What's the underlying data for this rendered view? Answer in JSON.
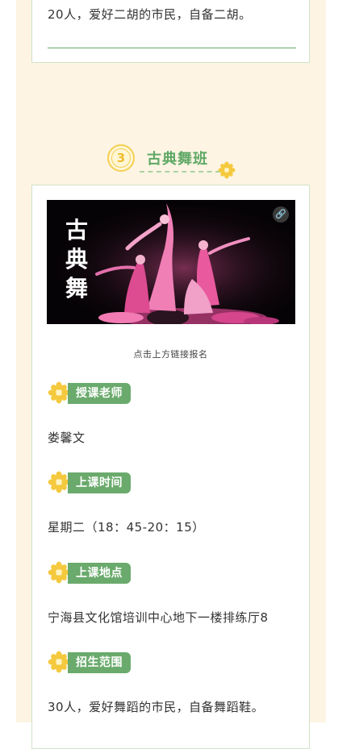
{
  "prev_section": {
    "capacity_text": "20人，爱好二胡的市民，自备二胡。"
  },
  "section": {
    "number": "3",
    "title": "古典舞班",
    "photo": {
      "title_chars": [
        "古",
        "典",
        "舞"
      ],
      "link_icon": "link-icon"
    },
    "caption": "点击上方链接报名",
    "fields": [
      {
        "label": "授课老师",
        "value": "娄馨文"
      },
      {
        "label": "上课时间",
        "value": "星期二（18：45-20：15）"
      },
      {
        "label": "上课地点",
        "value": "宁海县文化馆培训中心地下一楼排练厅8"
      },
      {
        "label": "招生范围",
        "value": "30人，爱好舞蹈的市民，自备舞蹈鞋。"
      }
    ]
  },
  "colors": {
    "page_background": "#fdf4e3",
    "accent_green": "#6aaa6c",
    "accent_yellow": "#f5cf52"
  }
}
